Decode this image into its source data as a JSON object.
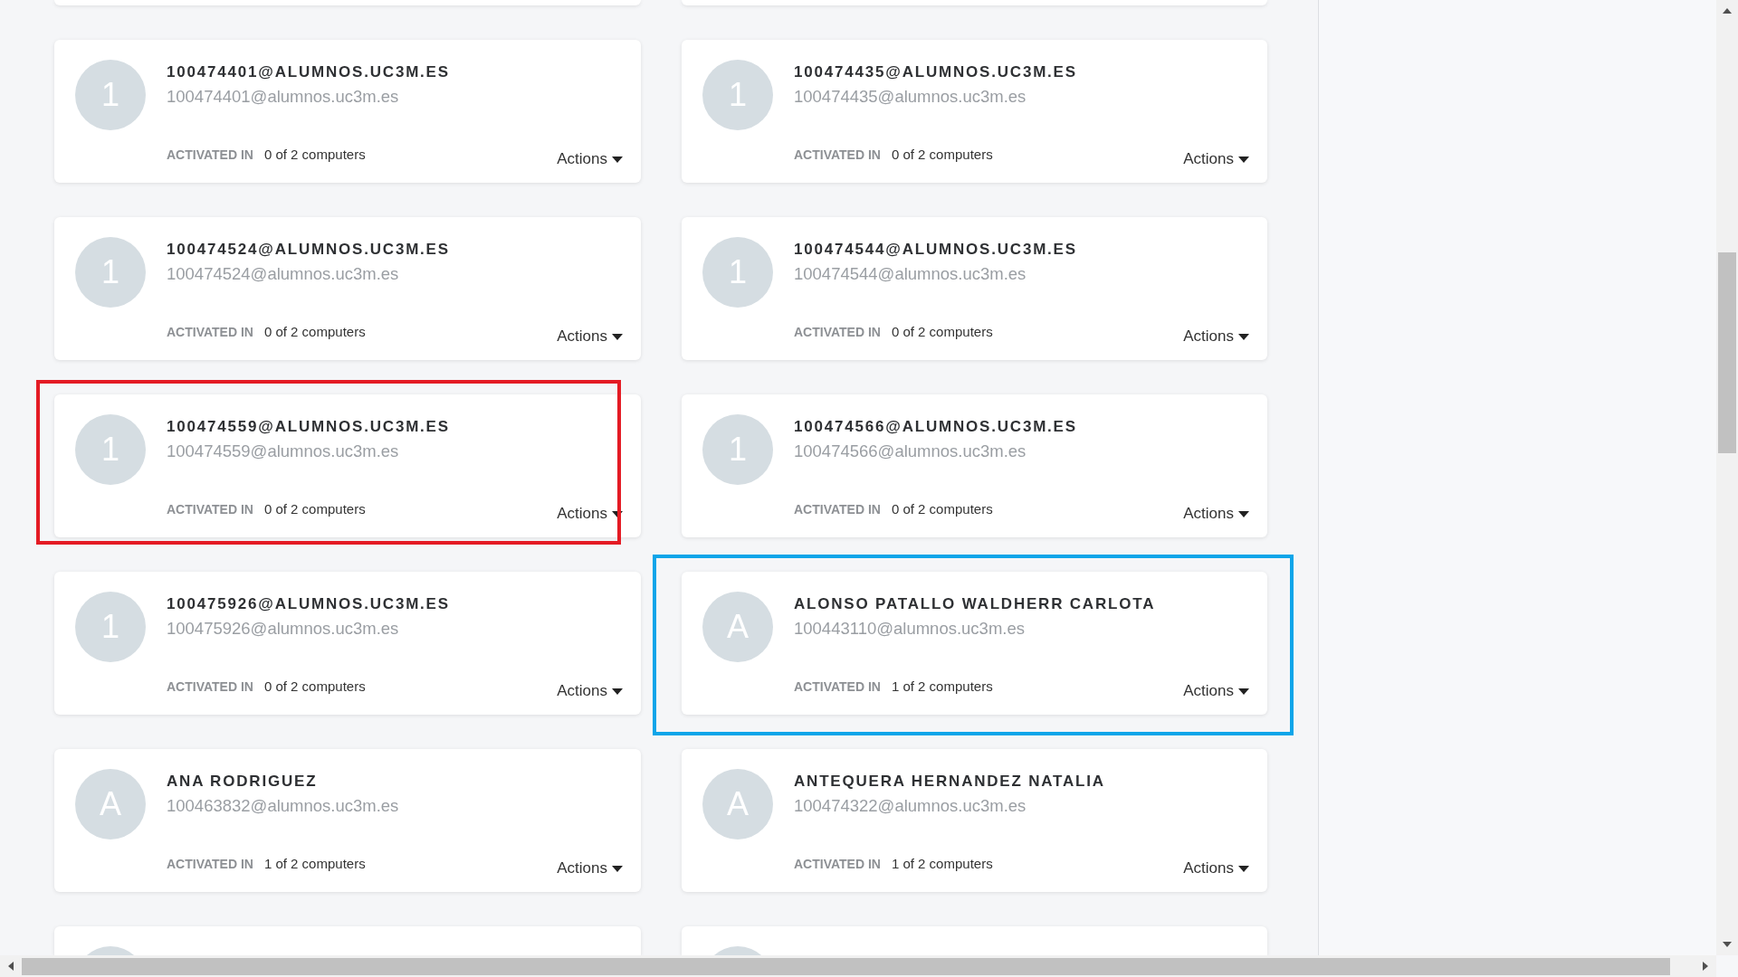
{
  "cards": [
    {
      "kind": "bottom_edge"
    },
    {
      "kind": "bottom_edge"
    },
    {
      "kind": "full",
      "avatar_letter": "1",
      "name": "100474401@ALUMNOS.UC3M.ES",
      "email": "100474401@alumnos.uc3m.es",
      "activation_label": "ACTIVATED IN",
      "activation_count": "0 of 2 computers",
      "actions_label": "Actions"
    },
    {
      "kind": "full",
      "avatar_letter": "1",
      "name": "100474435@ALUMNOS.UC3M.ES",
      "email": "100474435@alumnos.uc3m.es",
      "activation_label": "ACTIVATED IN",
      "activation_count": "0 of 2 computers",
      "actions_label": "Actions"
    },
    {
      "kind": "full",
      "avatar_letter": "1",
      "name": "100474524@ALUMNOS.UC3M.ES",
      "email": "100474524@alumnos.uc3m.es",
      "activation_label": "ACTIVATED IN",
      "activation_count": "0 of 2 computers",
      "actions_label": "Actions"
    },
    {
      "kind": "full",
      "avatar_letter": "1",
      "name": "100474544@ALUMNOS.UC3M.ES",
      "email": "100474544@alumnos.uc3m.es",
      "activation_label": "ACTIVATED IN",
      "activation_count": "0 of 2 computers",
      "actions_label": "Actions"
    },
    {
      "kind": "full",
      "avatar_letter": "1",
      "name": "100474559@ALUMNOS.UC3M.ES",
      "email": "100474559@alumnos.uc3m.es",
      "activation_label": "ACTIVATED IN",
      "activation_count": "0 of 2 computers",
      "actions_label": "Actions",
      "highlight": {
        "color": "#e41b24"
      }
    },
    {
      "kind": "full",
      "avatar_letter": "1",
      "name": "100474566@ALUMNOS.UC3M.ES",
      "email": "100474566@alumnos.uc3m.es",
      "activation_label": "ACTIVATED IN",
      "activation_count": "0 of 2 computers",
      "actions_label": "Actions"
    },
    {
      "kind": "full",
      "avatar_letter": "1",
      "name": "100475926@ALUMNOS.UC3M.ES",
      "email": "100475926@alumnos.uc3m.es",
      "activation_label": "ACTIVATED IN",
      "activation_count": "0 of 2 computers",
      "actions_label": "Actions"
    },
    {
      "kind": "full",
      "avatar_letter": "A",
      "name": "ALONSO PATALLO WALDHERR CARLOTA",
      "email": "100443110@alumnos.uc3m.es",
      "activation_label": "ACTIVATED IN",
      "activation_count": "1 of 2 computers",
      "actions_label": "Actions",
      "highlight": {
        "color": "#0ea5e9"
      }
    },
    {
      "kind": "full",
      "avatar_letter": "A",
      "name": "ANA RODRIGUEZ",
      "email": "100463832@alumnos.uc3m.es",
      "activation_label": "ACTIVATED IN",
      "activation_count": "1 of 2 computers",
      "actions_label": "Actions"
    },
    {
      "kind": "full",
      "avatar_letter": "A",
      "name": "ANTEQUERA HERNANDEZ NATALIA",
      "email": "100474322@alumnos.uc3m.es",
      "activation_label": "ACTIVATED IN",
      "activation_count": "1 of 2 computers",
      "actions_label": "Actions"
    },
    {
      "kind": "top_edge"
    },
    {
      "kind": "top_edge"
    }
  ]
}
